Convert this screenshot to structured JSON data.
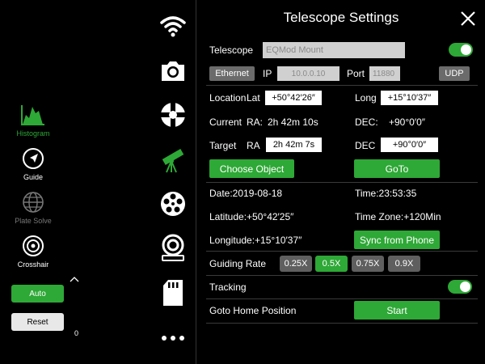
{
  "sidebar": {
    "items": [
      {
        "label": "Histogram",
        "icon": "histogram-icon"
      },
      {
        "label": "Guide",
        "icon": "guide-icon"
      },
      {
        "label": "Plate Solve",
        "icon": "globe-icon"
      },
      {
        "label": "Crosshair",
        "icon": "crosshair-icon"
      }
    ],
    "auto_label": "Auto",
    "reset_label": "Reset",
    "level_value": "0"
  },
  "iconbar": [
    "wifi-icon",
    "camera-icon",
    "focuser-icon",
    "telescope-icon",
    "filter-wheel-icon",
    "mount-icon",
    "sd-card-icon",
    "more-icon"
  ],
  "colors": {
    "accent": "#2ea836",
    "active_icon": "#2ea836"
  },
  "settings": {
    "title": "Telescope Settings",
    "telescope_label": "Telescope",
    "telescope_value": "EQMod Mount",
    "connection_label": "Ethernet",
    "ip_label": "IP",
    "ip_value": "10.0.0.10",
    "port_label": "Port",
    "port_value": "11880",
    "protocol_label": "UDP",
    "location_label": "Location",
    "lat_label": "Lat",
    "lat_value": "+50°42′26″",
    "long_label": "Long",
    "long_value": "+15°10′37″",
    "current_label": "Current",
    "current_ra_label": "RA:",
    "current_ra_value": "2h 42m 10s",
    "current_dec_label": "DEC:",
    "current_dec_value": "+90°0′0″",
    "target_label": "Target",
    "target_ra_label": "RA",
    "target_ra_value": "2h 42m 7s",
    "target_dec_label": "DEC",
    "target_dec_value": "+90°0′0″",
    "choose_object_label": "Choose Object",
    "goto_label": "GoTo",
    "date_text": "Date:2019-08-18",
    "time_text": "Time:23:53:35",
    "latitude_text": "Latitude:+50°42′25″",
    "timezone_text": "Time Zone:+120Min",
    "longitude_text": "Longitude:+15°10′37″",
    "sync_label": "Sync from Phone",
    "guiding_rate_label": "Guiding Rate",
    "rates": [
      "0.25X",
      "0.5X",
      "0.75X",
      "0.9X"
    ],
    "selected_rate": "0.5X",
    "tracking_label": "Tracking",
    "goto_home_label": "Goto Home Position",
    "start_label": "Start"
  }
}
